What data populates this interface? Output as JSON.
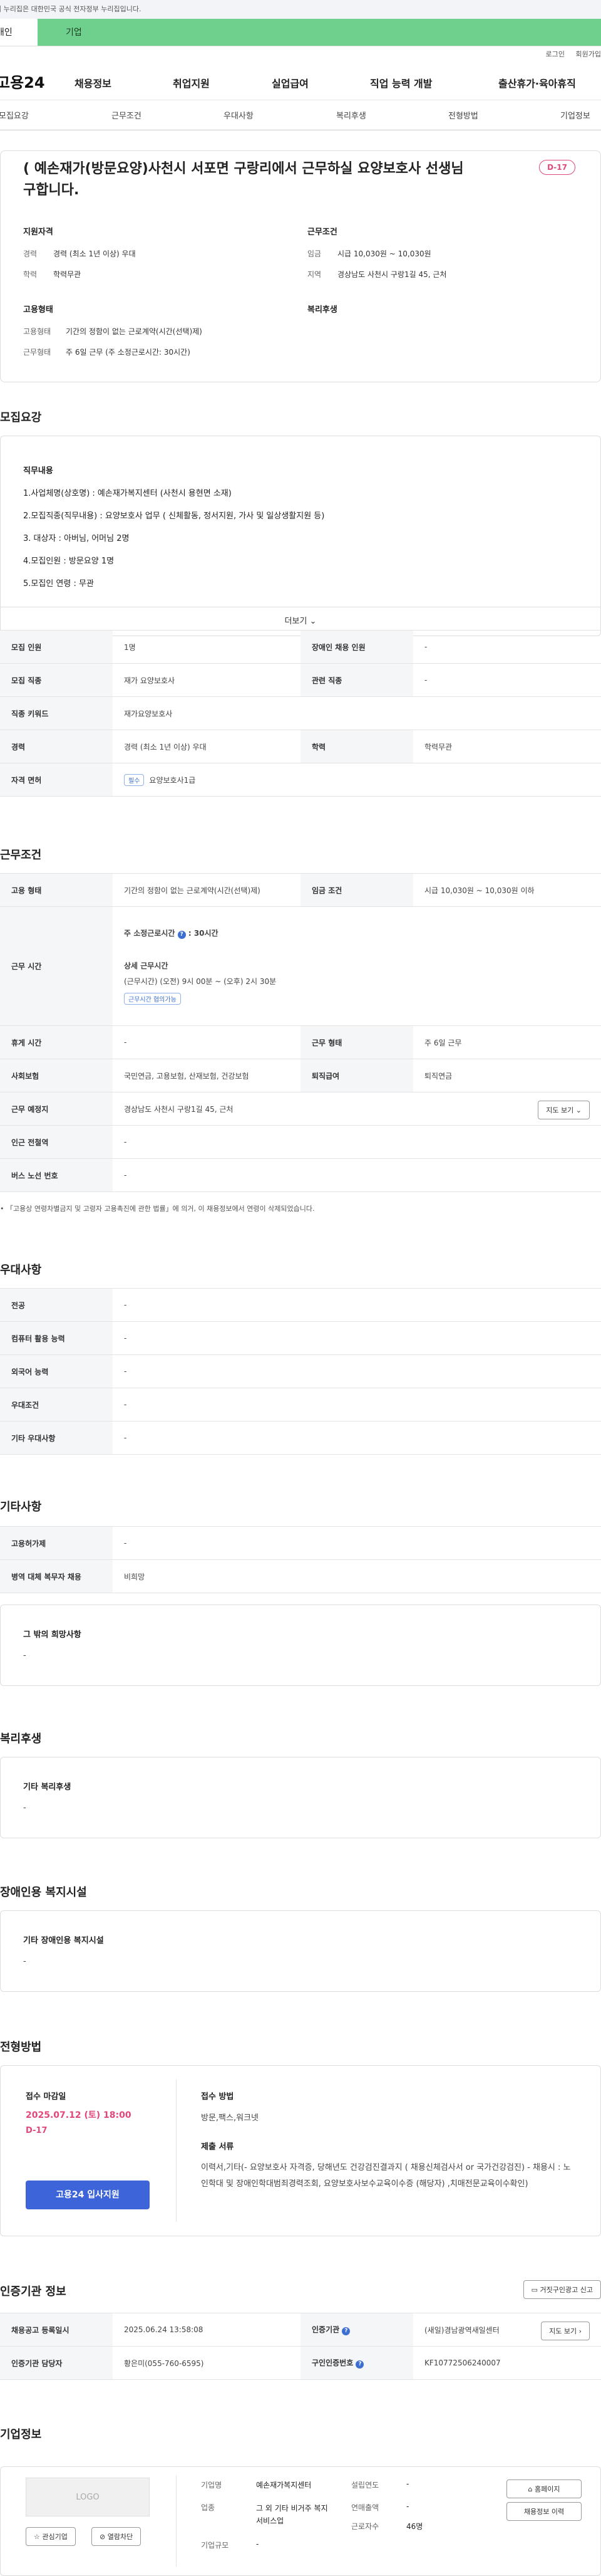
{
  "gov_banner": "이 누리집은 대한민국 공식 전자정부 누리집입니다.",
  "tabs": {
    "person": "개인",
    "company": "기업"
  },
  "util": {
    "login": "로그인",
    "join": "회원가입"
  },
  "header": {
    "logo": "고용24",
    "gnb": [
      "채용정보",
      "취업지원",
      "실업급여",
      "직업 능력 개발",
      "출산휴가·육아휴직"
    ]
  },
  "subnav": [
    "모집요강",
    "근무조건",
    "우대사항",
    "복리후생",
    "전형방법",
    "기업정보"
  ],
  "job": {
    "title": "( 예손재가(방문요양)사천시 서포면 구랑리에서 근무하실 요양보호사 선생님 구합니다.",
    "dday": "D-17",
    "qual_title": "지원자격",
    "qual": [
      {
        "k": "경력",
        "v": "경력 (최소 1년 이상) 우대"
      },
      {
        "k": "학력",
        "v": "학력무관"
      }
    ],
    "cond_title": "근무조건",
    "cond": [
      {
        "k": "임금",
        "v": "시급 10,030원 ~ 10,030원"
      },
      {
        "k": "지역",
        "v": "경상남도 사천시 구랑1길 45, 근처"
      }
    ],
    "emp_title": "고용형태",
    "emp": [
      {
        "k": "고용형태",
        "v": "기간의 정함이 없는 근로계약(시간(선택)제)"
      },
      {
        "k": "근무형태",
        "v": "주 6일 근무 (주 소정근로시간: 30시간)"
      }
    ],
    "welfare_title": "복리후생"
  },
  "recruit": {
    "section": "모집요강",
    "detail_title": "직무내용",
    "detail_lines": [
      "1.사업체명(상호명) : 예손재가복지센터 (사천시 용현면 소재)",
      "2.모집직종(직무내용) : 요양보호사 업무 ( 신체활동, 정서지원, 가사 및 일상생활지원 등)",
      "3. 대상자 : 아버님, 어머님  2명",
      "4.모집인원 : 방문요양  1명",
      "5.모집인 연령 : 무관"
    ],
    "more": "더보기",
    "table": {
      "r1": {
        "k1": "모집 인원",
        "v1": "1명",
        "k2": "장애인 채용 인원",
        "v2": "-"
      },
      "r2": {
        "k1": "모집 직종",
        "v1": "재가 요양보호사",
        "k2": "관련 직종",
        "v2": "-"
      },
      "r3": {
        "k1": "직종 키워드",
        "v1": "재가요양보호사"
      },
      "r4": {
        "k1": "경력",
        "v1": "경력 (최소 1년 이상) 우대",
        "k2": "학력",
        "v2": "학력무관"
      },
      "r5": {
        "k1": "자격 면허",
        "badge": "필수",
        "v1": "요양보호사1급"
      }
    }
  },
  "work": {
    "section": "근무조건",
    "emp_k": "고용 형태",
    "emp_v": "기간의 정함이 없는 근로계약(시간(선택)제)",
    "wage_k": "임금 조건",
    "wage_v": "시급 10,030원 ~ 10,030원 이하",
    "time_k": "근무 시간",
    "weekly": "주 소정근로시간",
    "weekly_v": ": 30시간",
    "detail_t": "상세 근무시간",
    "detail_v": "(근무시간) (오전) 9시 00분 ~ (오후) 2시 30분",
    "detail_badge": "근무시간 협의가능",
    "rest_k": "휴게 시간",
    "rest_v": "-",
    "type_k": "근무 형태",
    "type_v": "주 6일 근무",
    "ins_k": "사회보험",
    "ins_v": "국민연금, 고용보험, 산재보험, 건강보험",
    "sev_k": "퇴직급여",
    "sev_v": "퇴직연금",
    "place_k": "근무 예정지",
    "place_v": "경상남도 사천시 구랑1길 45, 근처",
    "map_btn": "지도 보기",
    "subway_k": "인근 전철역",
    "subway_v": "-",
    "bus_k": "버스 노선 번호",
    "bus_v": "-",
    "note": "「고용상 연령차별금지 및 고령자 고용촉진에 관한 법률」에 의거, 이 채용정보에서 연령이 삭제되었습니다."
  },
  "pref": {
    "section": "우대사항",
    "rows": [
      {
        "k": "전공",
        "v": "-"
      },
      {
        "k": "컴퓨터 활용 능력",
        "v": "-"
      },
      {
        "k": "외국어 능력",
        "v": "-"
      },
      {
        "k": "우대조건",
        "v": "-"
      },
      {
        "k": "기타 우대사항",
        "v": "-"
      }
    ]
  },
  "etc": {
    "section": "기타사항",
    "rows": [
      {
        "k": "고용허가제",
        "v": "-"
      },
      {
        "k": "병역 대체 복무자 채용",
        "v": "비희망"
      }
    ],
    "box_t": "그 밖의 희망사항",
    "box_v": "-"
  },
  "welfare": {
    "section": "복리후생",
    "box_t": "기타 복리후생",
    "box_v": "-"
  },
  "disabled": {
    "section": "장애인용 복지시설",
    "box_t": "기타 장애인용 복지시설",
    "box_v": "-"
  },
  "selection": {
    "section": "전형방법",
    "deadline_t": "접수 마감일",
    "deadline_v": "2025.07.12 (토) 18:00",
    "deadline_sub": "D-17",
    "apply_btn": "고용24 입사지원",
    "method_t": "접수 방법",
    "method_v": "방문,팩스,워크넷",
    "docs_t": "제출 서류",
    "docs_v": "이력서,기타(-  요양보호사 자격증, 당해년도 건강검진결과지 ( 채용신체검사서 or 국가건강검진)  -  채용시 : 노인학대 및 장애인학대범죄경력조회, 요양보호사보수교육이수증 (해당자) ,치매전문교육이수확인)"
  },
  "cert": {
    "section": "인증기관 정보",
    "report_btn": "거짓구인광고 신고",
    "reg_k": "채용공고 등록일시",
    "reg_v": "2025.06.24 13:58:08",
    "org_k": "인증기관",
    "org_v": "(새일)경남광역새일센터",
    "map_btn": "지도 보기",
    "mgr_k": "인증기관 담당자",
    "mgr_v": "황은미(055-760-6595)",
    "no_k": "구인인증번호",
    "no_v": "KF10772506240007"
  },
  "company": {
    "section": "기업정보",
    "logo": "LOGO",
    "fav_btn": "관심기업",
    "block_btn": "열람차단",
    "name_k": "기업명",
    "name_v": "예손재가복지센터",
    "ind_k": "업종",
    "ind_v": "그 외 기타 비거주 복지 서비스업",
    "size_k": "기업규모",
    "size_v": "-",
    "est_k": "설립연도",
    "est_v": "-",
    "sales_k": "연매출액",
    "sales_v": "-",
    "emp_k": "근로자수",
    "emp_v": "46명",
    "home_btn": "홈페이지",
    "list_btn": "채용정보 이력"
  }
}
